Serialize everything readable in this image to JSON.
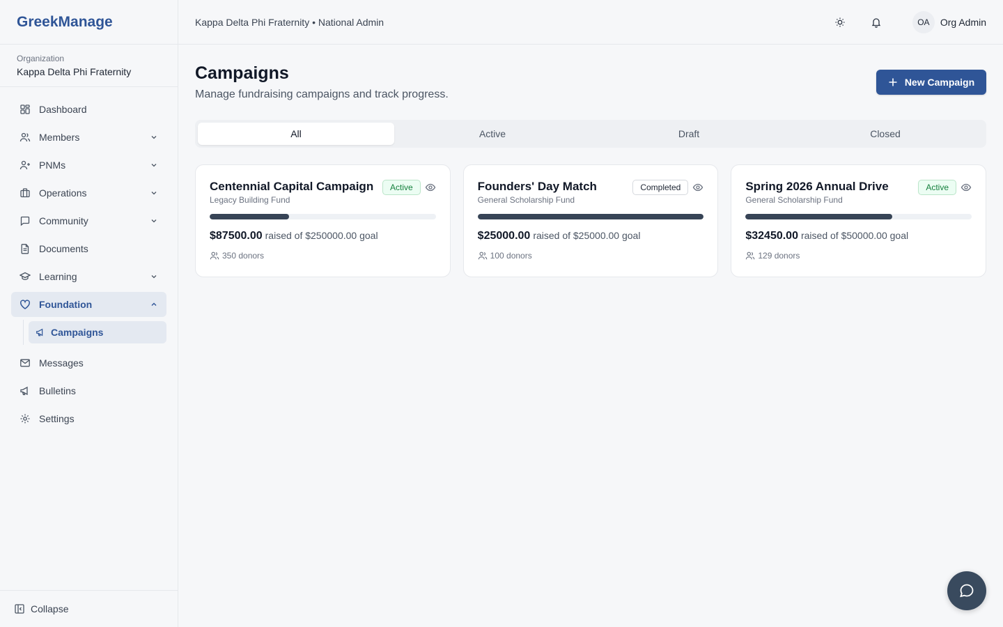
{
  "brand": "GreekManage",
  "organization": {
    "label": "Organization",
    "name": "Kappa Delta Phi Fraternity"
  },
  "header": {
    "title": "Kappa Delta Phi Fraternity • National Admin",
    "user_initials": "OA",
    "user_name": "Org Admin"
  },
  "nav": [
    {
      "label": "Dashboard",
      "icon": "grid-icon"
    },
    {
      "label": "Members",
      "icon": "users-icon",
      "expandable": true
    },
    {
      "label": "PNMs",
      "icon": "user-plus-icon",
      "expandable": true
    },
    {
      "label": "Operations",
      "icon": "briefcase-icon",
      "expandable": true
    },
    {
      "label": "Community",
      "icon": "message-square-icon",
      "expandable": true
    },
    {
      "label": "Documents",
      "icon": "file-icon"
    },
    {
      "label": "Learning",
      "icon": "graduation-cap-icon",
      "expandable": true
    },
    {
      "label": "Foundation",
      "icon": "heart-icon",
      "expandable": true,
      "open": true,
      "children": [
        {
          "label": "Campaigns",
          "icon": "megaphone-icon"
        }
      ]
    },
    {
      "label": "Messages",
      "icon": "mail-icon"
    },
    {
      "label": "Bulletins",
      "icon": "megaphone-icon"
    },
    {
      "label": "Settings",
      "icon": "gear-icon"
    }
  ],
  "collapse_label": "Collapse",
  "page": {
    "title": "Campaigns",
    "subtitle": "Manage fundraising campaigns and track progress.",
    "new_button": "New Campaign"
  },
  "tabs": [
    "All",
    "Active",
    "Draft",
    "Closed"
  ],
  "active_tab": "All",
  "campaigns": [
    {
      "title": "Centennial Capital Campaign",
      "fund": "Legacy Building Fund",
      "status": "Active",
      "raised": "$87500.00",
      "goal_text": "raised of $250000.00 goal",
      "progress": 0.35,
      "donors": "350 donors"
    },
    {
      "title": "Founders' Day Match",
      "fund": "General Scholarship Fund",
      "status": "Completed",
      "raised": "$25000.00",
      "goal_text": "raised of $25000.00 goal",
      "progress": 1.0,
      "donors": "100 donors"
    },
    {
      "title": "Spring 2026 Annual Drive",
      "fund": "General Scholarship Fund",
      "status": "Active",
      "raised": "$32450.00",
      "goal_text": "raised of $50000.00 goal",
      "progress": 0.649,
      "donors": "129 donors"
    }
  ],
  "colors": {
    "brand": "#2f5597",
    "progress": "#374456",
    "active_badge": "#15803d"
  }
}
